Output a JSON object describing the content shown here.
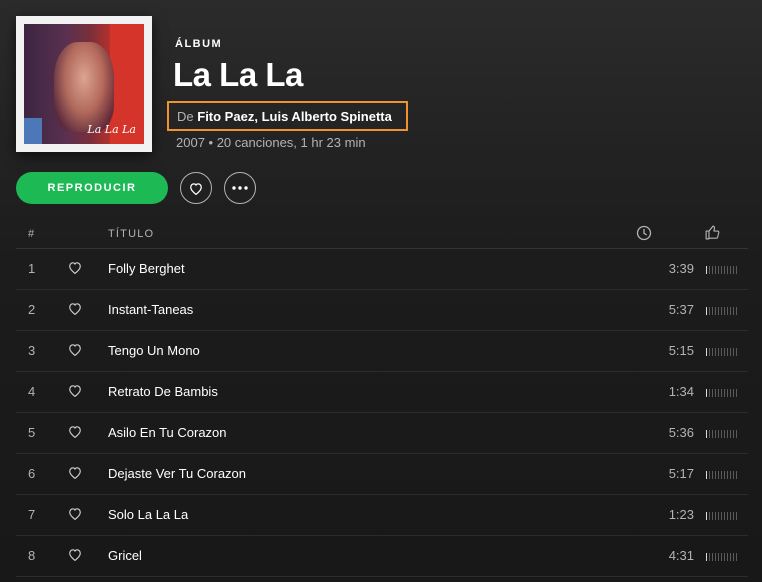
{
  "album": {
    "type_label": "ÁLBUM",
    "title": "La La La",
    "by_prefix": "De",
    "artist1": "Fito Paez",
    "separator": ",",
    "artist2": "Luis Alberto Spinetta",
    "meta": "2007 • 20 canciones, 1 hr 23 min",
    "cover_signature": "La La La"
  },
  "actions": {
    "play_label": "REPRODUCIR"
  },
  "table": {
    "header_num": "#",
    "header_title": "TÍTULO"
  },
  "tracks": [
    {
      "num": "1",
      "title": "Folly Berghet",
      "duration": "3:39",
      "popularity": 0.1
    },
    {
      "num": "2",
      "title": "Instant-Taneas",
      "duration": "5:37",
      "popularity": 0.1
    },
    {
      "num": "3",
      "title": "Tengo Un Mono",
      "duration": "5:15",
      "popularity": 0.1
    },
    {
      "num": "4",
      "title": "Retrato De Bambis",
      "duration": "1:34",
      "popularity": 0.1
    },
    {
      "num": "5",
      "title": "Asilo En Tu Corazon",
      "duration": "5:36",
      "popularity": 0.1
    },
    {
      "num": "6",
      "title": "Dejaste Ver Tu Corazon",
      "duration": "5:17",
      "popularity": 0.1
    },
    {
      "num": "7",
      "title": "Solo La La La",
      "duration": "1:23",
      "popularity": 0.1
    },
    {
      "num": "8",
      "title": "Gricel",
      "duration": "4:31",
      "popularity": 0.1
    }
  ],
  "icons": {
    "heart": "heart-icon",
    "more": "more-icon",
    "clock": "clock-icon",
    "thumb": "thumbs-up-icon"
  },
  "colors": {
    "accent": "#1db954",
    "highlight_box": "#f0922e"
  }
}
